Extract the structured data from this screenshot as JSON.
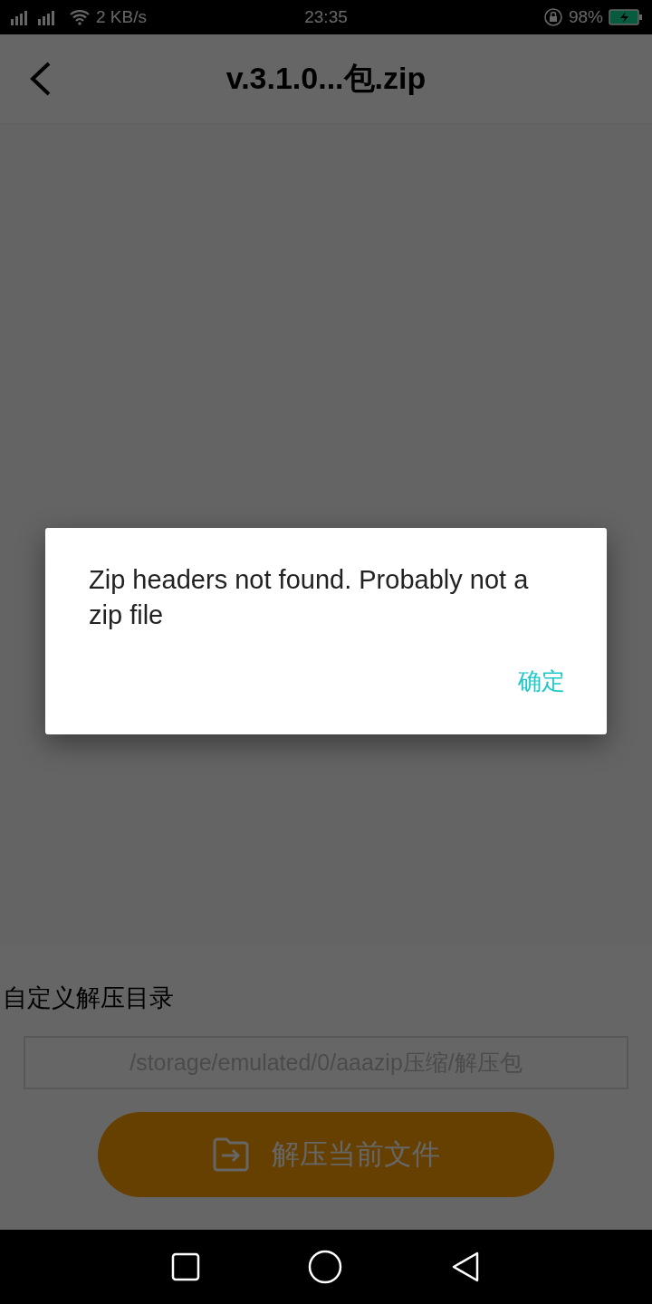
{
  "status_bar": {
    "speed": "2 KB/s",
    "time": "23:35",
    "battery": "98%",
    "charging": true
  },
  "header": {
    "title": "v.3.1.0...包.zip"
  },
  "extract": {
    "label": "自定义解压目录",
    "path_field": {
      "placeholder": "/storage/emulated/0/aaazip压缩/解压包"
    },
    "button": "解压当前文件"
  },
  "dialog": {
    "message": "Zip headers not found. Probably not a zip file",
    "buttons": [
      "确定"
    ]
  }
}
